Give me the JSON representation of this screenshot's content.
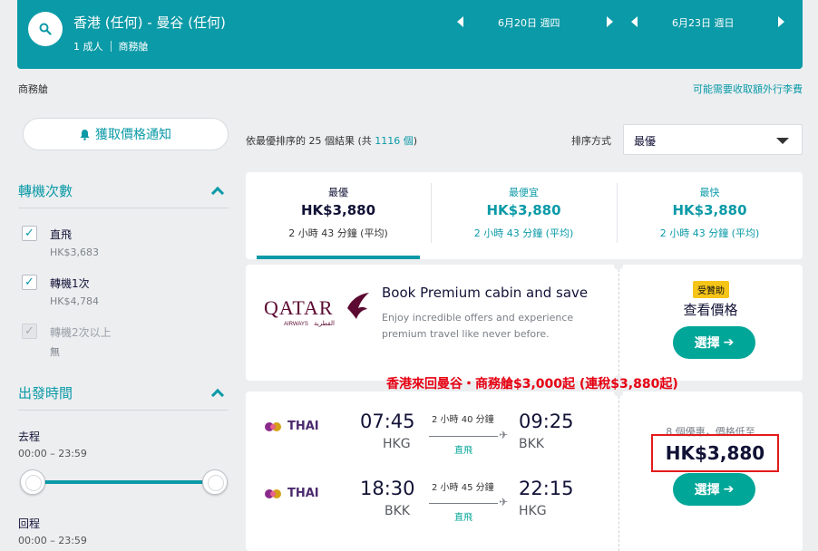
{
  "search": {
    "route": "香港 (任何) - 曼谷 (任何)",
    "passengers": "1 成人",
    "cabin": "商務艙",
    "depart_date": "6月20日 週四",
    "return_date": "6月23日 週日"
  },
  "subbar": {
    "cabin_label": "商務艙",
    "baggage_link": "可能需要收取額外行李費"
  },
  "sidebar": {
    "price_alert_label": "獲取價格通知",
    "stops_title": "轉機次數",
    "stops": [
      {
        "label": "直飛",
        "price": "HK$3,683",
        "checked": true,
        "disabled": false
      },
      {
        "label": "轉機1次",
        "price": "HK$4,784",
        "checked": true,
        "disabled": false
      },
      {
        "label": "轉機2次以上",
        "price": "無",
        "checked": true,
        "disabled": true
      }
    ],
    "times_title": "出發時間",
    "outbound_label": "去程",
    "outbound_range": "00:00 – 23:59",
    "return_label": "回程",
    "return_range": "00:00 – 23:59"
  },
  "results": {
    "count_text": "依最優排序的 25 個結果 (共 ",
    "count_link": "1116 個",
    "count_suffix": ")",
    "sort_label": "排序方式",
    "sort_value": "最優"
  },
  "tabs": [
    {
      "label": "最優",
      "price": "HK$3,880",
      "duration": "2 小時 43 分鐘 (平均)"
    },
    {
      "label": "最便宜",
      "price": "HK$3,880",
      "duration": "2 小時 43 分鐘 (平均)"
    },
    {
      "label": "最快",
      "price": "HK$3,880",
      "duration": "2 小時 43 分鐘 (平均)"
    }
  ],
  "ad": {
    "logo_text": "QATAR",
    "logo_sub": "AIRWAYS",
    "logo_arabic": "القطرية",
    "title": "Book Premium cabin and save",
    "desc": "Enjoy incredible offers and experience premium travel like never before.",
    "sponsored": "受贊助",
    "view_price": "查看價格",
    "select_label": "選擇"
  },
  "promo_text": "香港來回曼谷・商務艙$3,000起 (連稅$3,880起)",
  "flight": {
    "airline": "THAI",
    "legs": [
      {
        "dep_time": "07:45",
        "dep_code": "HKG",
        "duration": "2 小時 40 分鐘",
        "stops": "直飛",
        "arr_time": "09:25",
        "arr_code": "BKK"
      },
      {
        "dep_time": "18:30",
        "dep_code": "BKK",
        "duration": "2 小時 45 分鐘",
        "stops": "直飛",
        "arr_time": "22:15",
        "arr_code": "HKG"
      }
    ],
    "deals_text": "8 個優惠，價格低至",
    "price": "HK$3,880",
    "select_label": "選擇"
  },
  "colors": {
    "accent": "#0b9aa7",
    "select": "#00a698",
    "promo": "#e60012",
    "highlight_border": "#e21c1c"
  }
}
